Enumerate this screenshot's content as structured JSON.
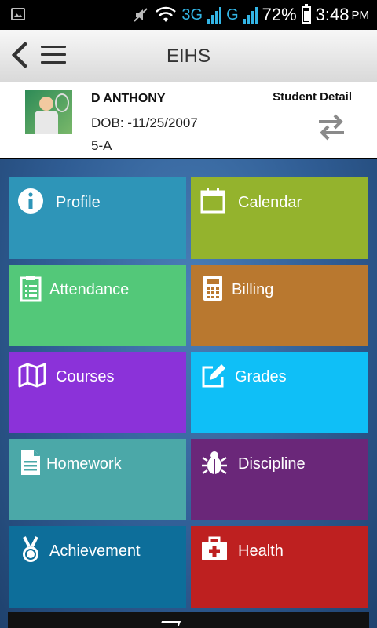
{
  "status_bar": {
    "network": "3G",
    "network2": "G",
    "battery": "72%",
    "time": "3:48",
    "ampm": "PM"
  },
  "app_bar": {
    "title": "EIHS"
  },
  "student": {
    "name": "D ANTHONY",
    "dob": "DOB: -11/25/2007",
    "class": "5-A",
    "detail_label": "Student Detail"
  },
  "tiles": [
    {
      "label": "Profile",
      "color": "#2e95b8",
      "icon": "info-icon"
    },
    {
      "label": "Calendar",
      "color": "#94b32d",
      "icon": "calendar-icon"
    },
    {
      "label": "Attendance",
      "color": "#53c879",
      "icon": "clipboard-icon"
    },
    {
      "label": "Billing",
      "color": "#b9782f",
      "icon": "calculator-icon"
    },
    {
      "label": "Courses",
      "color": "#8b32d9",
      "icon": "map-icon"
    },
    {
      "label": "Grades",
      "color": "#0fbff7",
      "icon": "edit-icon"
    },
    {
      "label": "Homework",
      "color": "#4ba8a8",
      "icon": "document-icon"
    },
    {
      "label": "Discipline",
      "color": "#6a2779",
      "icon": "bug-icon"
    },
    {
      "label": "Achievement",
      "color": "#0d6e9a",
      "icon": "medal-icon"
    },
    {
      "label": "Health",
      "color": "#be2020",
      "icon": "first-aid-icon"
    }
  ]
}
